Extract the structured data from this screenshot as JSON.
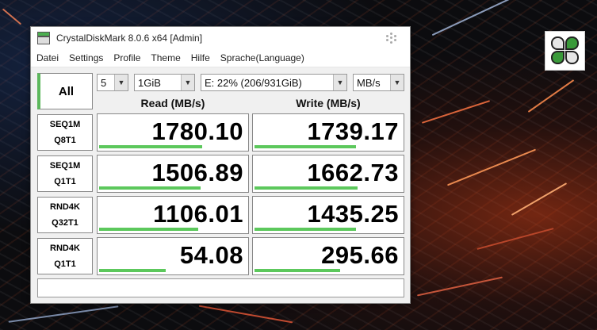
{
  "window": {
    "title": "CrystalDiskMark 8.0.6 x64 [Admin]"
  },
  "menu": [
    "Datei",
    "Settings",
    "Profile",
    "Theme",
    "Hilfe",
    "Sprache(Language)"
  ],
  "controls": {
    "all_label": "All",
    "count": "5",
    "size": "1GiB",
    "drive": "E: 22% (206/931GiB)",
    "unit": "MB/s"
  },
  "headers": {
    "read": "Read (MB/s)",
    "write": "Write (MB/s)"
  },
  "rows": [
    {
      "line1": "SEQ1M",
      "line2": "Q8T1",
      "read": "1780.10",
      "write": "1739.17",
      "read_fill": 0.7,
      "write_fill": 0.69
    },
    {
      "line1": "SEQ1M",
      "line2": "Q1T1",
      "read": "1506.89",
      "write": "1662.73",
      "read_fill": 0.69,
      "write_fill": 0.7
    },
    {
      "line1": "RND4K",
      "line2": "Q32T1",
      "read": "1106.01",
      "write": "1435.25",
      "read_fill": 0.67,
      "write_fill": 0.69
    },
    {
      "line1": "RND4K",
      "line2": "Q1T1",
      "read": "54.08",
      "write": "295.66",
      "read_fill": 0.45,
      "write_fill": 0.58
    }
  ],
  "status_text": "",
  "colors": {
    "accent_green": "#5cc85c",
    "window_bg": "#f0f0f0"
  }
}
